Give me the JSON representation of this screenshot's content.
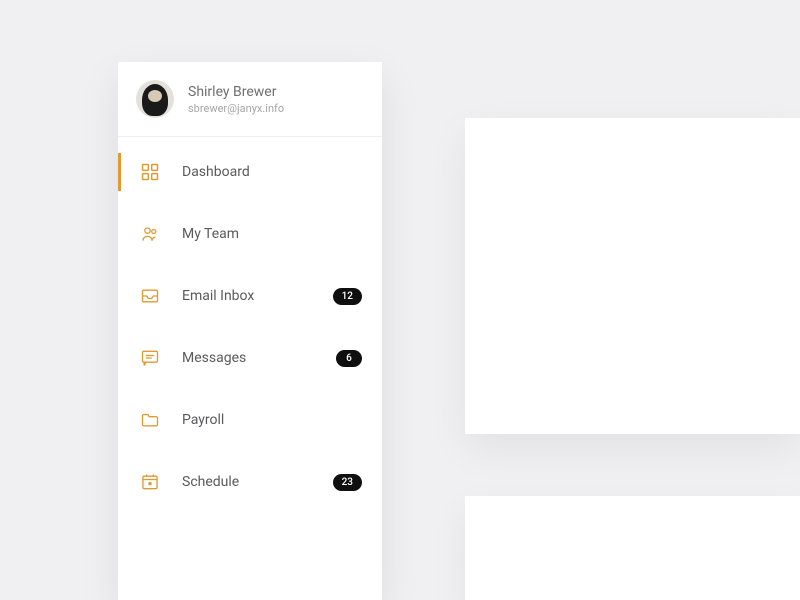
{
  "user": {
    "name": "Shirley Brewer",
    "email": "sbrewer@janyx.info"
  },
  "nav": [
    {
      "id": "dashboard",
      "label": "Dashboard",
      "icon": "grid-icon",
      "active": true,
      "badge": null
    },
    {
      "id": "my-team",
      "label": "My Team",
      "icon": "team-icon",
      "active": false,
      "badge": null
    },
    {
      "id": "email-inbox",
      "label": "Email Inbox",
      "icon": "inbox-icon",
      "active": false,
      "badge": "12"
    },
    {
      "id": "messages",
      "label": "Messages",
      "icon": "chat-icon",
      "active": false,
      "badge": "6"
    },
    {
      "id": "payroll",
      "label": "Payroll",
      "icon": "folder-icon",
      "active": false,
      "badge": null
    },
    {
      "id": "schedule",
      "label": "Schedule",
      "icon": "calendar-icon",
      "active": false,
      "badge": "23"
    }
  ],
  "colors": {
    "accent": "#e09a33",
    "badge_bg": "#0f0f10"
  }
}
